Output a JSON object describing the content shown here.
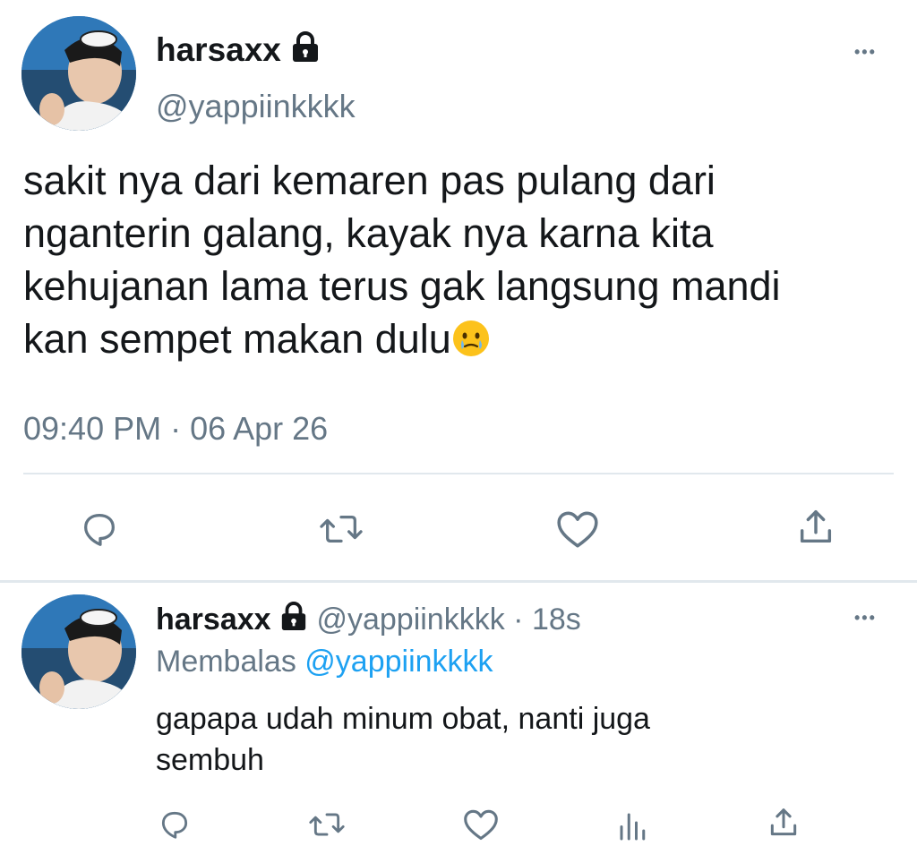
{
  "main_tweet": {
    "display_name": "harsaxx",
    "handle": "@yappiinkkkk",
    "text": "sakit nya dari kemaren pas pulang dari nganterin galang, kayak nya karna kita kehujanan lama terus gak langsung mandi kan sempet makan dulu",
    "lines": [
      "sakit nya dari kemaren pas pulang dari",
      "nganterin galang, kayak nya karna kita",
      "kehujanan lama terus gak langsung mandi",
      "kan sempet makan dulu"
    ],
    "emoji": "face-holding-back-tears",
    "timestamp": "09:40 PM · 06 Apr 26",
    "more_label": "•••"
  },
  "reply_tweet": {
    "display_name": "harsaxx",
    "handle": "@yappiinkkkk",
    "separator": "·",
    "age": "18s",
    "replying_prefix": "Membalas",
    "replying_to": "@yappiinkkkk",
    "lines": [
      "gapapa udah minum obat, nanti juga",
      "sembuh"
    ],
    "more_label": "•••"
  },
  "icons": {
    "lock": "lock-icon",
    "reply": "reply-icon",
    "retweet": "retweet-icon",
    "like": "like-icon",
    "share": "share-icon",
    "analytics": "analytics-icon"
  },
  "colors": {
    "text": "#14171a",
    "muted": "#657786",
    "link": "#1da1f2",
    "divider": "#e1e8ed"
  }
}
